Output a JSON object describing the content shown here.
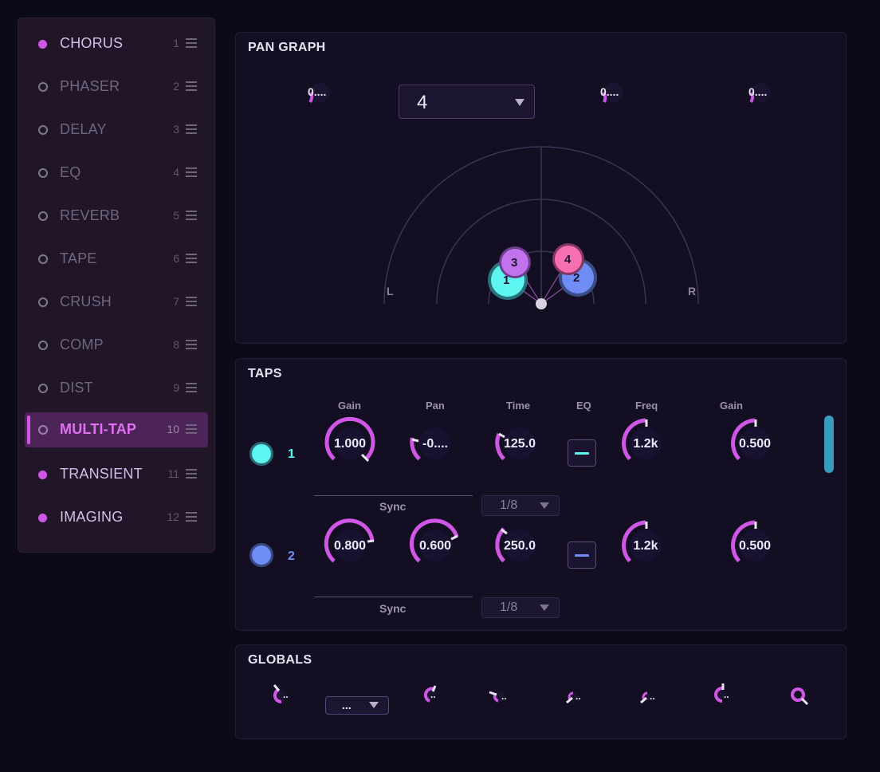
{
  "sidebar": {
    "items": [
      {
        "label": "CHORUS",
        "num": "1",
        "enabled": true,
        "active": false
      },
      {
        "label": "PHASER",
        "num": "2",
        "enabled": false,
        "active": false
      },
      {
        "label": "DELAY",
        "num": "3",
        "enabled": false,
        "active": false
      },
      {
        "label": "EQ",
        "num": "4",
        "enabled": false,
        "active": false
      },
      {
        "label": "REVERB",
        "num": "5",
        "enabled": false,
        "active": false
      },
      {
        "label": "TAPE",
        "num": "6",
        "enabled": false,
        "active": false
      },
      {
        "label": "CRUSH",
        "num": "7",
        "enabled": false,
        "active": false
      },
      {
        "label": "COMP",
        "num": "8",
        "enabled": false,
        "active": false
      },
      {
        "label": "DIST",
        "num": "9",
        "enabled": false,
        "active": false
      },
      {
        "label": "MULTI-TAP",
        "num": "10",
        "enabled": false,
        "active": true
      },
      {
        "label": "TRANSIENT",
        "num": "11",
        "enabled": true,
        "active": false
      },
      {
        "label": "IMAGING",
        "num": "12",
        "enabled": true,
        "active": false
      }
    ]
  },
  "pan_graph": {
    "title": "PAN GRAPH",
    "knob_values": [
      "0....",
      "0....",
      "0...."
    ],
    "tap_count": "4",
    "left_label": "L",
    "right_label": "R",
    "nodes": [
      "1",
      "2",
      "3",
      "4"
    ]
  },
  "taps": {
    "title": "TAPS",
    "headers": {
      "gain": "Gain",
      "pan": "Pan",
      "time": "Time",
      "eq": "EQ",
      "freq": "Freq",
      "eq_gain": "Gain"
    },
    "rows": [
      {
        "num": "1",
        "gain": "1.000",
        "pan": "-0....",
        "time": "125.0",
        "freq": "1.2k",
        "eq_gain": "0.500",
        "sync_label": "Sync",
        "sync_value": "1/8"
      },
      {
        "num": "2",
        "gain": "0.800",
        "pan": "0.600",
        "time": "250.0",
        "freq": "1.2k",
        "eq_gain": "0.500",
        "sync_label": "Sync",
        "sync_value": "1/8"
      }
    ]
  },
  "globals": {
    "title": "GLOBALS",
    "select_value": "...",
    "knob_values": [
      "..",
      "..",
      "..",
      "..",
      "..",
      "..",
      "..",
      ".."
    ]
  },
  "colors": {
    "accent": "#d056e6",
    "tap1": "#5ef5f0",
    "tap2": "#6f8df5",
    "tap3": "#c173ee",
    "tap4": "#f66fb0",
    "scrollbar": "#3a9bc0"
  },
  "icons": {
    "drag_handle": "drag-handle-icon",
    "dropdown": "chevron-down-icon",
    "eq_toggle": "minus-icon"
  }
}
